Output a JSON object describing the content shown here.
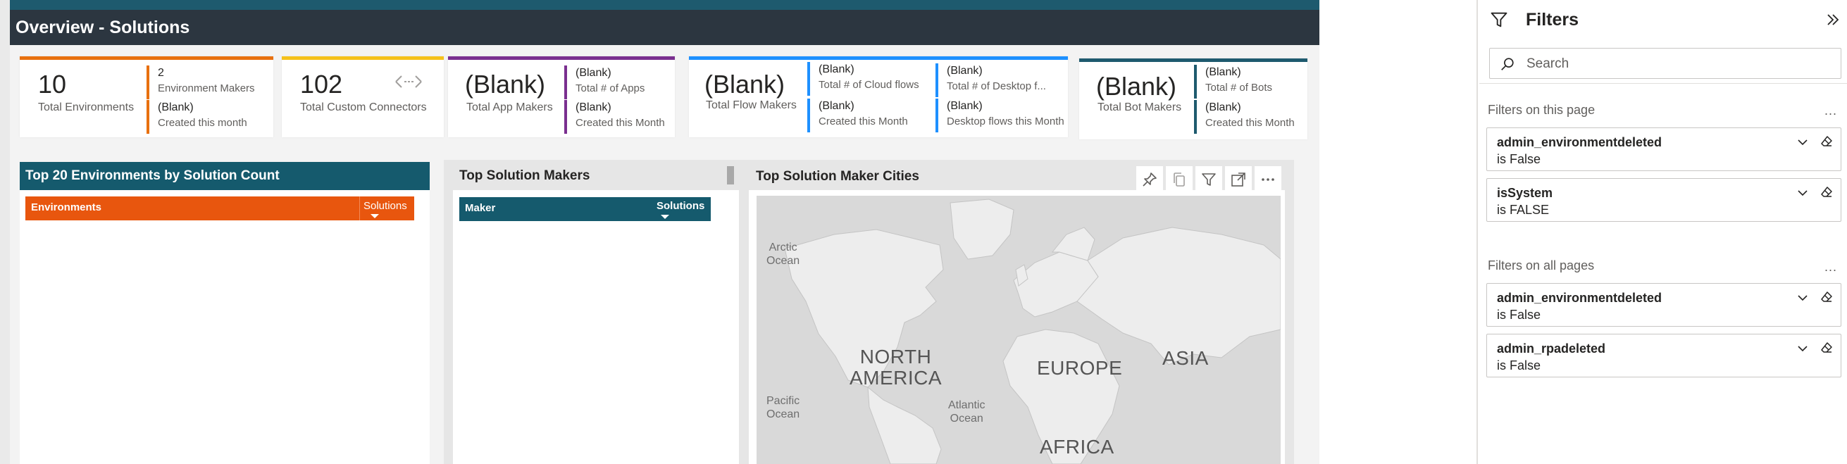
{
  "report": {
    "title": "Overview - Solutions"
  },
  "kpi_cards": [
    {
      "value": "10",
      "label": "Total Environments",
      "accent": "#e8700e",
      "subs": [
        {
          "value": "2",
          "label": "Environment Makers"
        },
        {
          "value": "(Blank)",
          "label": "Created this month"
        }
      ]
    },
    {
      "value": "102",
      "label": "Total Custom Connectors",
      "accent": "#f5c11a",
      "icon": "connector-arrows-icon",
      "subs": []
    },
    {
      "value": "(Blank)",
      "label": "Total App Makers",
      "accent": "#7a2f8f",
      "subs": [
        {
          "value": "(Blank)",
          "label": "Total # of Apps"
        },
        {
          "value": "(Blank)",
          "label": "Created this Month"
        }
      ]
    },
    {
      "value": "(Blank)",
      "label": "Total Flow Makers",
      "accent": "#1e90ff",
      "subs": [
        {
          "value": "(Blank)",
          "label": "Total # of Cloud flows"
        },
        {
          "value": "(Blank)",
          "label": "Created this Month"
        },
        {
          "value": "(Blank)",
          "label": "Total # of Desktop f..."
        },
        {
          "value": "(Blank)",
          "label": "Desktop flows this Month"
        }
      ]
    },
    {
      "value": "(Blank)",
      "label": "Total Bot Makers",
      "accent": "#1e5a6e",
      "subs": [
        {
          "value": "(Blank)",
          "label": "Total # of Bots"
        },
        {
          "value": "(Blank)",
          "label": "Created this Month"
        }
      ]
    }
  ],
  "env_table": {
    "title": "Top 20 Environments by Solution Count",
    "columns": [
      "Environments",
      "Solutions"
    ]
  },
  "makers_table": {
    "title": "Top Solution Makers",
    "columns": [
      "Maker",
      "Solutions"
    ]
  },
  "map": {
    "title": "Top Solution Maker Cities",
    "labels": {
      "arctic": "Arctic\nOcean",
      "north_america": "NORTH\nAMERICA",
      "europe": "EUROPE",
      "asia": "ASIA",
      "pacific": "Pacific\nOcean",
      "atlantic": "Atlantic\nOcean",
      "africa": "AFRICA"
    },
    "toolbar": [
      "pin-icon",
      "copy-icon",
      "filter-icon",
      "focus-mode-icon",
      "more-options-icon"
    ]
  },
  "filters": {
    "title": "Filters",
    "search_placeholder": "Search",
    "this_page_title": "Filters on this page",
    "all_pages_title": "Filters on all pages",
    "more": "...",
    "this_page": [
      {
        "name": "admin_environmentdeleted",
        "condition": "is False"
      },
      {
        "name": "isSystem",
        "condition": "is FALSE"
      }
    ],
    "all_pages": [
      {
        "name": "admin_environmentdeleted",
        "condition": "is False"
      },
      {
        "name": "admin_rpadeleted",
        "condition": "is False"
      }
    ]
  },
  "colors": {
    "title_bar": "#2c3640",
    "teal": "#1e5a6e",
    "orange": "#e8560e",
    "map_bg": "#d9d9d9"
  }
}
